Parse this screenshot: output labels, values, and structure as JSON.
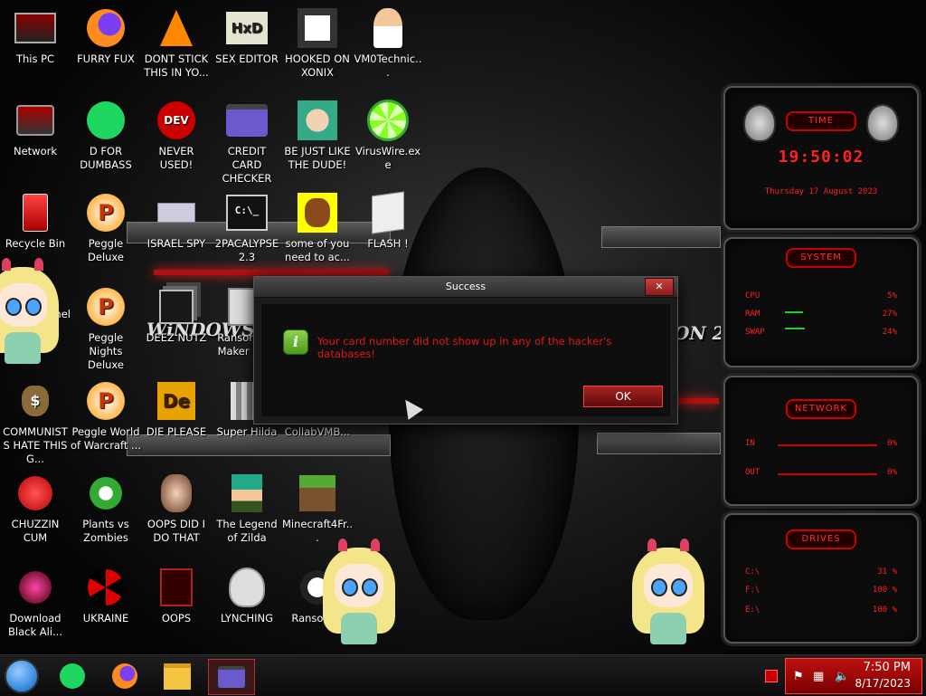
{
  "desktop": {
    "icons": [
      {
        "label": "This PC",
        "icon": "monitor-icon"
      },
      {
        "label": "FURRY FUX",
        "icon": "firefox-icon"
      },
      {
        "label": "DONT STICK THIS IN YO...",
        "icon": "vlc-cone-icon"
      },
      {
        "label": "SEX EDITOR",
        "icon": "hxd-icon"
      },
      {
        "label": "HOOKED ON XONIX",
        "icon": "xonix-icon"
      },
      {
        "label": "VM0Technic...",
        "icon": "doctor-icon"
      },
      {
        "label": "Network",
        "icon": "network-icon"
      },
      {
        "label": "D FOR DUMBASS",
        "icon": "spotify-icon"
      },
      {
        "label": "NEVER USED!",
        "icon": "devcpp-icon"
      },
      {
        "label": "CREDIT CARD CHECKER",
        "icon": "credit-card-icon"
      },
      {
        "label": "BE JUST LIKE THE DUDE!",
        "icon": "elf-icon"
      },
      {
        "label": "VirusWire.exe",
        "icon": "lime-icon"
      },
      {
        "label": "Recycle Bin",
        "icon": "recycle-bin-icon"
      },
      {
        "label": "Peggle Deluxe",
        "icon": "peggle-icon"
      },
      {
        "label": "ISRAEL SPY",
        "icon": "spy-icon"
      },
      {
        "label": "2PACALYPSE 2.3",
        "icon": "terminal-icon"
      },
      {
        "label": "some of you need to ac...",
        "icon": "beaver-icon"
      },
      {
        "label": "FLASH !",
        "icon": "flash-icon"
      },
      {
        "label": "Peggle Nights Deluxe",
        "icon": "peggle-icon"
      },
      {
        "label": "DEEZ NUTZ",
        "icon": "stack-icon"
      },
      {
        "label": "Ransomw... Maker Bu...",
        "icon": "window-icon"
      },
      {
        "label": "COMMUNISTS HATE THIS G...",
        "icon": "money-bag-icon"
      },
      {
        "label": "Peggle World of Warcraft ...",
        "icon": "peggle-icon"
      },
      {
        "label": "DIE PLEASE",
        "icon": "aftereffects-icon"
      },
      {
        "label": "Super Hilda",
        "icon": "pixel-icon"
      },
      {
        "label": "CollabVMB...",
        "icon": "blank-icon"
      },
      {
        "label": "CHUZZIN CUM",
        "icon": "chuzzle-icon"
      },
      {
        "label": "Plants vs Zombies",
        "icon": "plant-icon"
      },
      {
        "label": "OOPS DID I DO THAT",
        "icon": "portrait-icon"
      },
      {
        "label": "The Legend of Zilda",
        "icon": "link-icon"
      },
      {
        "label": "Minecraft4Fr...",
        "icon": "grass-block-icon"
      },
      {
        "label": "Download Black Ali...",
        "icon": "orb-icon"
      },
      {
        "label": "UKRAINE",
        "icon": "radiation-icon"
      },
      {
        "label": "OOPS",
        "icon": "oops-icon"
      },
      {
        "label": "LYNCHING",
        "icon": "shield-icon"
      },
      {
        "label": "Ransom...",
        "icon": "panda-icon"
      },
      {
        "label": "...nel",
        "icon": "control-panel-icon"
      }
    ],
    "wallpaper": {
      "text_left": "WiNDOWS 8.1",
      "text_right": "ON 20"
    }
  },
  "dialog": {
    "title": "Success",
    "close": "✕",
    "message": "Your card number did not show up in any of the hacker's databases!",
    "ok_label": "OK",
    "icon": "info-icon"
  },
  "gadgets": {
    "time": {
      "header": "TIME",
      "clock": "19:50:02",
      "date": "Thursday 17 August 2023"
    },
    "system": {
      "header": "SYSTEM",
      "rows": [
        {
          "k": "CPU",
          "v": "5%"
        },
        {
          "k": "RAM",
          "v": "27%"
        },
        {
          "k": "SWAP",
          "v": "24%"
        }
      ]
    },
    "network": {
      "header": "NETWORK",
      "rows": [
        {
          "k": "IN",
          "v": "0%"
        },
        {
          "k": "OUT",
          "v": "0%"
        }
      ]
    },
    "drives": {
      "header": "DRIVES",
      "rows": [
        {
          "k": "C:\\",
          "v": "31 %"
        },
        {
          "k": "F:\\",
          "v": "100 %"
        },
        {
          "k": "E:\\",
          "v": "100 %"
        }
      ]
    }
  },
  "taskbar": {
    "time": "7:50 PM",
    "date": "8/17/2023",
    "buttons": [
      "start-orb-icon",
      "spotify-icon",
      "firefox-icon",
      "file-explorer-icon",
      "credit-card-app-icon"
    ]
  },
  "colors": {
    "accent": "#e01818",
    "gadget_red": "#ff2020",
    "ok_button": "#a22222"
  }
}
